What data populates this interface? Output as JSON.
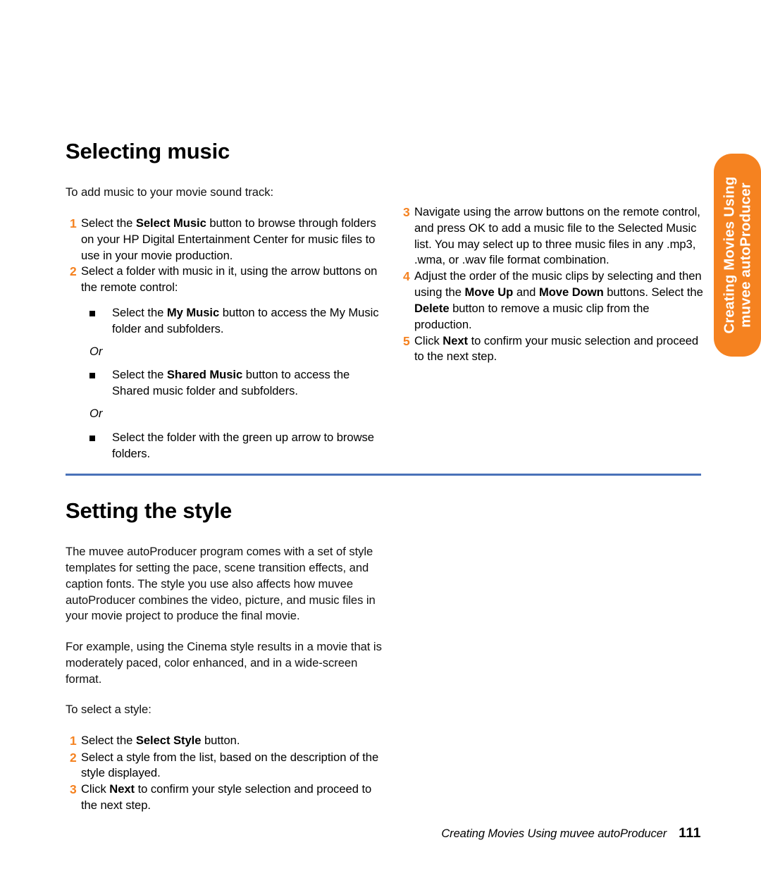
{
  "side_tab": {
    "line1": "Creating Movies Using",
    "line2": "muvee autoProducer",
    "background_color": "#F58220",
    "text_color": "#FFFFFF"
  },
  "colors": {
    "list_number": "#F58220",
    "divider": "#4A72B8",
    "body_text": "#111111"
  },
  "sections": [
    {
      "id": "selecting-music",
      "title": "Selecting music",
      "intro": "To add music to your movie sound track:",
      "left_steps": [
        {
          "number": "1",
          "parts": [
            {
              "text": "Select the ",
              "bold": false
            },
            {
              "text": "Select Music",
              "bold": true
            },
            {
              "text": " button to browse through folders on your HP Digital Entertainment Center for music files to use in your movie production.",
              "bold": false
            }
          ]
        },
        {
          "number": "2",
          "parts": [
            {
              "text": "Select a folder with music in it, using the arrow buttons on the remote control:",
              "bold": false
            }
          ],
          "sub_items": [
            {
              "type": "bullet",
              "parts": [
                {
                  "text": "Select the ",
                  "bold": false
                },
                {
                  "text": "My Music",
                  "bold": true
                },
                {
                  "text": " button to access the My Music folder and subfolders.",
                  "bold": false
                }
              ]
            },
            {
              "type": "or",
              "text": "Or"
            },
            {
              "type": "bullet",
              "parts": [
                {
                  "text": "Select the ",
                  "bold": false
                },
                {
                  "text": "Shared Music",
                  "bold": true
                },
                {
                  "text": " button to access the Shared music folder and subfolders.",
                  "bold": false
                }
              ]
            },
            {
              "type": "or",
              "text": "Or"
            },
            {
              "type": "bullet",
              "parts": [
                {
                  "text": "Select the folder with the green up arrow to browse folders.",
                  "bold": false
                }
              ]
            }
          ]
        }
      ],
      "right_steps": [
        {
          "number": "3",
          "parts": [
            {
              "text": "Navigate using the arrow buttons on the remote control, and press OK to add a music file to the Selected Music list. You may select up to three music files in any .mp3, .wma, or .wav file format combination.",
              "bold": false
            }
          ]
        },
        {
          "number": "4",
          "parts": [
            {
              "text": "Adjust the order of the music clips by selecting and then using the ",
              "bold": false
            },
            {
              "text": "Move Up",
              "bold": true
            },
            {
              "text": " and ",
              "bold": false
            },
            {
              "text": "Move Down",
              "bold": true
            },
            {
              "text": " buttons. Select the ",
              "bold": false
            },
            {
              "text": "Delete",
              "bold": true
            },
            {
              "text": " button to remove a music clip from the production.",
              "bold": false
            }
          ]
        },
        {
          "number": "5",
          "parts": [
            {
              "text": "Click ",
              "bold": false
            },
            {
              "text": "Next",
              "bold": true
            },
            {
              "text": " to confirm your music selection and proceed to the next step.",
              "bold": false
            }
          ]
        }
      ]
    },
    {
      "id": "setting-the-style",
      "title": "Setting the style",
      "paragraphs": [
        "The muvee autoProducer program comes with a set of style templates for setting the pace, scene transition effects, and caption fonts. The style you use also affects how muvee autoProducer combines the video, picture, and music files in your movie project to produce the final movie.",
        "For example, using the Cinema style results in a movie that is moderately paced, color enhanced, and in a wide-screen format.",
        "To select a style:"
      ],
      "steps": [
        {
          "number": "1",
          "parts": [
            {
              "text": "Select the ",
              "bold": false
            },
            {
              "text": "Select Style",
              "bold": true
            },
            {
              "text": " button.",
              "bold": false
            }
          ]
        },
        {
          "number": "2",
          "parts": [
            {
              "text": "Select a style from the list, based on the description of the style displayed.",
              "bold": false
            }
          ]
        },
        {
          "number": "3",
          "parts": [
            {
              "text": "Click ",
              "bold": false
            },
            {
              "text": "Next",
              "bold": true
            },
            {
              "text": " to confirm your style selection and proceed to the next step.",
              "bold": false
            }
          ]
        }
      ]
    }
  ],
  "footer": {
    "text": "Creating Movies Using muvee autoProducer",
    "page_number": "111"
  }
}
